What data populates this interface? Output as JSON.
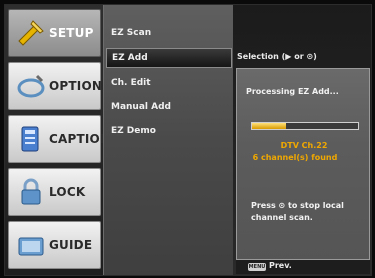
{
  "tabs": [
    {
      "label": "SETUP",
      "icon": "setup-icon",
      "active": true
    },
    {
      "label": "OPTION",
      "icon": "option-icon",
      "active": false
    },
    {
      "label": "CAPTION",
      "icon": "caption-icon",
      "active": false
    },
    {
      "label": "LOCK",
      "icon": "lock-icon",
      "active": false
    },
    {
      "label": "GUIDE",
      "icon": "guide-icon",
      "active": false
    }
  ],
  "menu": {
    "items": [
      {
        "label": "EZ Scan",
        "selected": false
      },
      {
        "label": "EZ Add",
        "selected": true
      },
      {
        "label": "Ch. Edit",
        "selected": false
      },
      {
        "label": "Manual Add",
        "selected": false
      },
      {
        "label": "EZ Demo",
        "selected": false
      }
    ]
  },
  "selection_hint": "Selection (▶ or ⊙)",
  "popup": {
    "title": "Processing EZ Add...",
    "progress": 0.32,
    "channel": "DTV Ch.22",
    "found": "6 channel(s) found",
    "stop_text": "Press ⊙ to stop local channel scan."
  },
  "bottom": {
    "key_label": "MENU",
    "prev_label": "Prev."
  },
  "colors": {
    "highlight": "#f0a800",
    "menu_bg": "#4a4a4a",
    "panel_bg": "#5c5c5c"
  }
}
